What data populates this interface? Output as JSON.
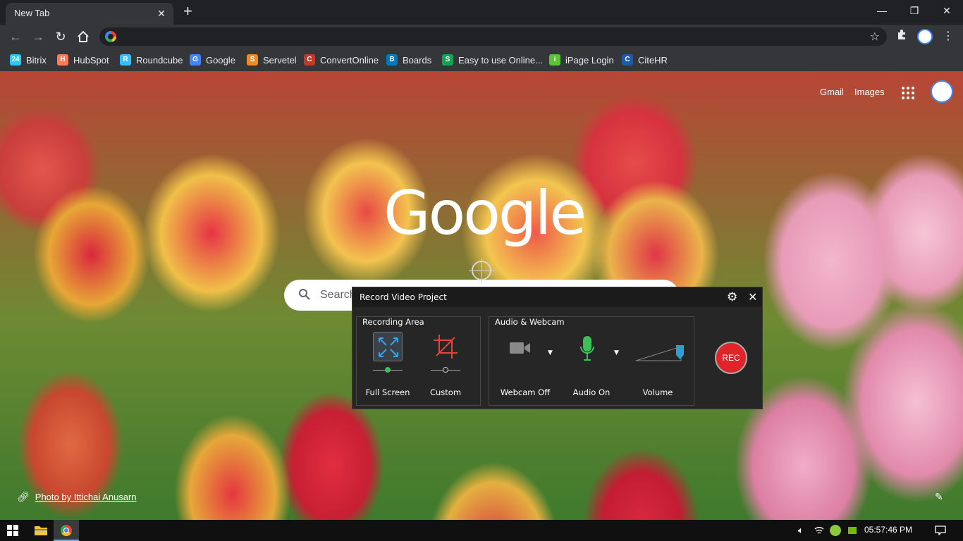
{
  "browser": {
    "tab_title": "New Tab",
    "tab_close": "✕",
    "new_tab": "+",
    "window_controls": {
      "minimize": "—",
      "restore": "❐",
      "close": "✕"
    },
    "omnibox_value": "",
    "bookmarks": [
      {
        "label": "Bitrix",
        "icon": "bitrix-icon",
        "icon_text": "24",
        "color": "#2fc6f6"
      },
      {
        "label": "HubSpot",
        "icon": "hubspot-icon",
        "icon_text": "H",
        "color": "#ff7a59"
      },
      {
        "label": "Roundcube",
        "icon": "roundcube-icon",
        "icon_text": "R",
        "color": "#37beff"
      },
      {
        "label": "Google",
        "icon": "google-icon",
        "icon_text": "G",
        "color": "#4285f4"
      },
      {
        "label": "Servetel",
        "icon": "servetel-icon",
        "icon_text": "S",
        "color": "#f08a24"
      },
      {
        "label": "ConvertOnline",
        "icon": "convertonline-icon",
        "icon_text": "C",
        "color": "#c0392b"
      },
      {
        "label": "Boards",
        "icon": "trello-icon",
        "icon_text": "B",
        "color": "#0079bf"
      },
      {
        "label": "Easy to use Online...",
        "icon": "easy-online-icon",
        "icon_text": "S",
        "color": "#12a454"
      },
      {
        "label": "iPage Login",
        "icon": "ipage-icon",
        "icon_text": "i",
        "color": "#5bc236"
      },
      {
        "label": "CiteHR",
        "icon": "citehr-icon",
        "icon_text": "C",
        "color": "#1e5aa8"
      }
    ]
  },
  "newtab": {
    "gmail": "Gmail",
    "images": "Images",
    "logo": "Google",
    "search_placeholder": "Search",
    "photo_credit": "Photo by Ittichai Anusarn"
  },
  "recorder": {
    "title": "Record Video Project",
    "recording_area_title": "Recording Area",
    "full_screen_label": "Full Screen",
    "custom_label": "Custom",
    "audio_webcam_title": "Audio & Webcam",
    "webcam_label": "Webcam Off",
    "audio_label": "Audio On",
    "volume_label": "Volume",
    "rec_label": "REC",
    "selected_area": "Full Screen",
    "volume_level": 1.0
  },
  "taskbar": {
    "clock": "05:57:46 PM"
  }
}
